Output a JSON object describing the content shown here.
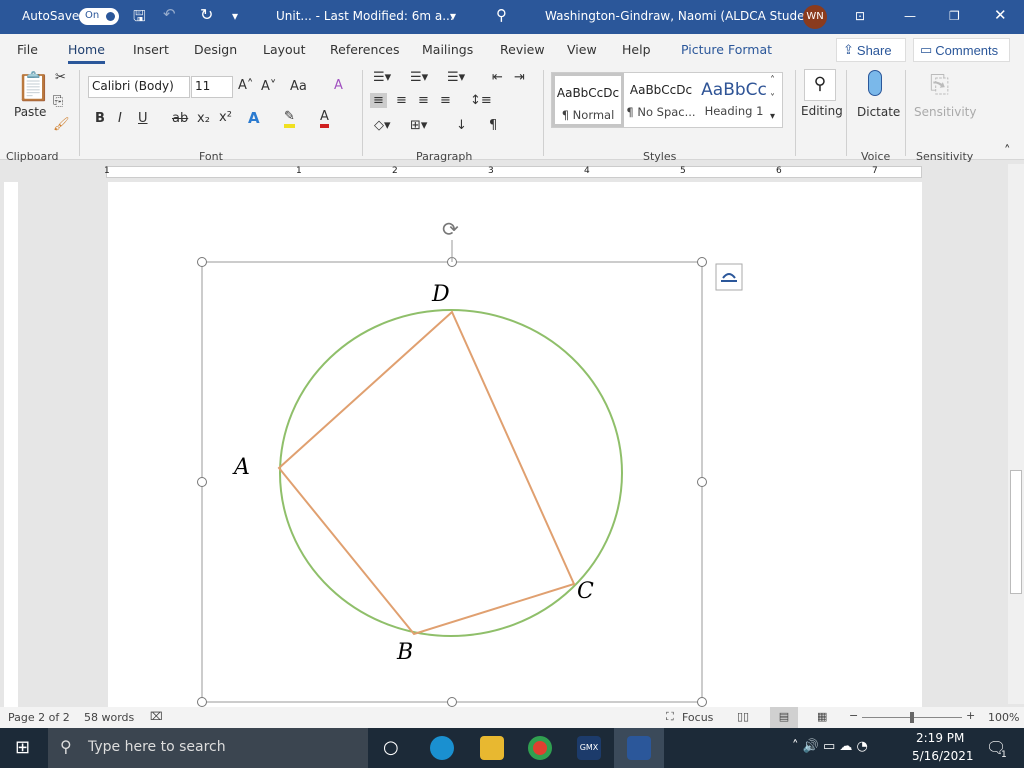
{
  "titlebar": {
    "autosave": "AutoSave",
    "toggle": "On",
    "doc_title": "Unit...  -  Last Modified: 6m a...",
    "user": "Washington-Gindraw, Naomi (ALDCA Student)",
    "initials": "WN",
    "accent": "#2b579a"
  },
  "tabs": [
    "File",
    "Home",
    "Insert",
    "Design",
    "Layout",
    "References",
    "Mailings",
    "Review",
    "View",
    "Help",
    "Picture Format"
  ],
  "share": "Share",
  "comments": "Comments",
  "ribbon": {
    "paste": "Paste",
    "font_name": "Calibri (Body)",
    "font_size": "11",
    "change_case": "Aa",
    "styles": [
      {
        "preview": "AaBbCcDc",
        "label": "¶ Normal"
      },
      {
        "preview": "AaBbCcDc",
        "label": "¶ No Spac..."
      },
      {
        "preview": "AaBbCc",
        "label": "Heading 1"
      }
    ],
    "editing": "Editing",
    "dictate": "Dictate",
    "sensitivity": "Sensitivity",
    "groups": [
      "Clipboard",
      "Font",
      "Paragraph",
      "Styles",
      "Voice",
      "Sensitivity"
    ]
  },
  "ruler_numbers": [
    "1",
    "1",
    "2",
    "3",
    "4",
    "5",
    "6",
    "7"
  ],
  "diagram": {
    "labels": {
      "A": "A",
      "B": "B",
      "C": "C",
      "D": "D"
    },
    "circle_color": "#8fbf6a",
    "quad_color": "#e0a070"
  },
  "status": {
    "page": "Page 2 of 2",
    "words": "58 words",
    "focus": "Focus",
    "zoom": "100%"
  },
  "taskbar": {
    "search_placeholder": "Type here to search",
    "time": "2:19 PM",
    "date": "5/16/2021",
    "notifications": "1"
  }
}
